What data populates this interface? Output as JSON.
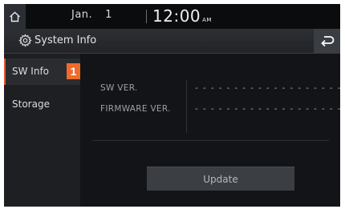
{
  "status_bar": {
    "month": "Jan.",
    "day": "1",
    "time": "12:00",
    "ampm": "AM"
  },
  "title_bar": {
    "title": "System Info",
    "settings_icon": "gear-icon",
    "back_icon": "back-arrow-icon"
  },
  "sidebar": {
    "items": [
      {
        "label": "SW Info",
        "badge": "1",
        "active": true
      },
      {
        "label": "Storage",
        "active": false
      }
    ]
  },
  "info": {
    "rows": [
      {
        "label": "SW VER.",
        "value": "- - - - - - - - - - - - - - - - - - - -"
      },
      {
        "label": "FIRMWARE VER.",
        "value": "- - - - - - - - - - - - - - - - - - - -"
      }
    ]
  },
  "actions": {
    "update_label": "Update"
  },
  "colors": {
    "accent": "#ef6b2c",
    "background": "#17191c"
  }
}
